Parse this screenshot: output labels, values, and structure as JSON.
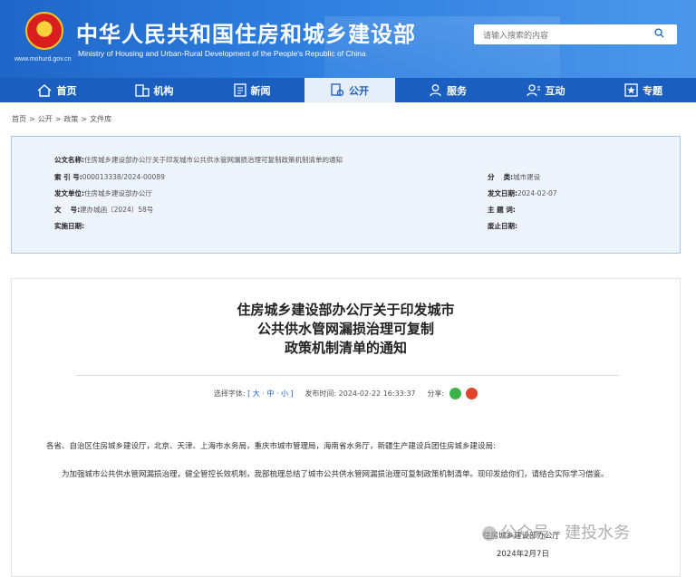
{
  "header": {
    "title": "中华人民共和国住房和城乡建设部",
    "subtitle": "Ministry of Housing and Urban-Rural Development of the People's Republic of China",
    "url": "www.mohurd.gov.cn",
    "search_placeholder": "请输入搜索的内容"
  },
  "nav": [
    {
      "label": "首页",
      "icon": "home-icon"
    },
    {
      "label": "机构",
      "icon": "building-icon"
    },
    {
      "label": "新闻",
      "icon": "news-icon"
    },
    {
      "label": "公开",
      "icon": "open-icon",
      "active": true
    },
    {
      "label": "服务",
      "icon": "user-service-icon"
    },
    {
      "label": "互动",
      "icon": "interact-icon"
    },
    {
      "label": "专题",
      "icon": "topic-icon"
    }
  ],
  "breadcrumb": [
    "首页",
    ">",
    "公开",
    ">",
    "政策",
    ">",
    "文件库"
  ],
  "meta": {
    "doc_name_label": "公文名称:",
    "doc_name": "住房城乡建设部办公厅关于印发城市公共供水管网漏损治理可复制政策机制清单的通知",
    "index_label": "索 引 号:",
    "index": "000013338/2024-00089",
    "category_label": "分　 类:",
    "category": "城市建设",
    "issuer_label": "发文单位:",
    "issuer": "住房城乡建设部办公厅",
    "issue_date_label": "发文日期:",
    "issue_date": "2024-02-07",
    "doc_no_label": "文　 号:",
    "doc_no": "建办城函〔2024〕58号",
    "subject_label": "主 题 词:",
    "subject": "",
    "effective_label": "实施日期:",
    "effective": "",
    "repeal_label": "废止日期:",
    "repeal": ""
  },
  "article": {
    "title_lines": [
      "住房城乡建设部办公厅关于印发城市",
      "公共供水管网漏损治理可复制",
      "政策机制清单的通知"
    ],
    "font_label": "选择字体:",
    "font_sizes": "[ 大 · 中 · 小 ]",
    "published_label": "发布时间:",
    "published": "2024-02-22 16:33:37",
    "share_label": "分享:",
    "recipients": "各省、自治区住房城乡建设厅，北京、天津、上海市水务局，重庆市城市管理局，海南省水务厅，新疆生产建设兵团住房城乡建设局:",
    "body": "为加强城市公共供水管网漏损治理，健全管控长效机制，我部梳理总结了城市公共供水管网漏损治理可复制政策机制清单。现印发给你们，请结合实际学习借鉴。",
    "signature": "住房城乡建设部办公厅",
    "sign_date": "2024年2月7日"
  },
  "watermark": "公众号 · 建投水务",
  "colors": {
    "brand": "#1a5fc0",
    "share_wechat": "#3bb34a",
    "share_weibo": "#e0452c"
  }
}
